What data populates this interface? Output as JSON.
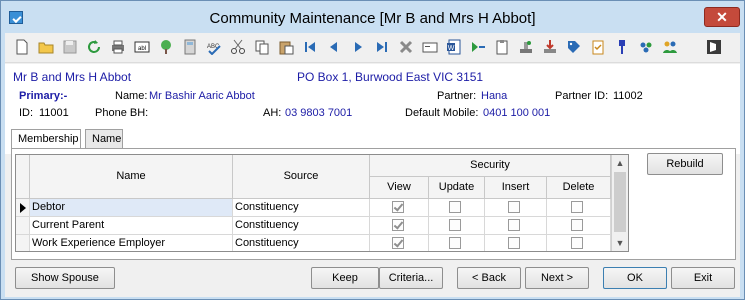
{
  "window": {
    "title": "Community Maintenance  [Mr B and Mrs H Abbot]"
  },
  "toolbar": {
    "icons": [
      "new-icon",
      "open-icon",
      "save-icon",
      "refresh-icon",
      "print-icon",
      "abl-icon",
      "tree-icon",
      "calculator-icon",
      "spell-check-icon",
      "cut-icon",
      "copy-icon",
      "paste-icon",
      "first-record-icon",
      "previous-record-icon",
      "next-record-icon",
      "last-record-icon",
      "delete-icon",
      "card-icon",
      "word-icon",
      "merge-icon",
      "clipboard-icon",
      "stamp-icon",
      "download-icon",
      "tag-icon",
      "checklist-icon",
      "pin-icon",
      "group-icon",
      "people-icon",
      "exit-icon"
    ]
  },
  "contact": {
    "name": "Mr B and Mrs H Abbot",
    "address": "PO Box 1, Burwood East VIC 3151",
    "primary_label": "Primary:-",
    "name_label": "Name:",
    "full_name": "Mr Bashir Aaric Abbot",
    "partner_label": "Partner:",
    "partner": "Hana",
    "partner_id_label": "Partner ID:",
    "partner_id": "11002",
    "id_label": "ID:",
    "id": "11001",
    "phone_bh_label": "Phone BH:",
    "phone_bh": "",
    "ah_label": "AH:",
    "ah": "03 9803 7001",
    "mobile_label": "Default Mobile:",
    "mobile": "0401 100 001"
  },
  "tabs": [
    {
      "label": "Membership"
    },
    {
      "label": "Name"
    }
  ],
  "grid": {
    "headers": {
      "name": "Name",
      "source": "Source",
      "security": "Security",
      "view": "View",
      "update": "Update",
      "insert": "Insert",
      "delete": "Delete"
    },
    "rows": [
      {
        "name": "Debtor",
        "source": "Constituency",
        "view": true,
        "update": false,
        "insert": false,
        "delete": false
      },
      {
        "name": "Current Parent",
        "source": "Constituency",
        "view": true,
        "update": false,
        "insert": false,
        "delete": false
      },
      {
        "name": "Work Experience Employer",
        "source": "Constituency",
        "view": true,
        "update": false,
        "insert": false,
        "delete": false
      }
    ]
  },
  "buttons": {
    "rebuild": "Rebuild",
    "show_spouse": "Show Spouse",
    "keep": "Keep",
    "criteria": "Criteria...",
    "back": "< Back",
    "next": "Next >",
    "ok": "OK",
    "exit": "Exit"
  }
}
